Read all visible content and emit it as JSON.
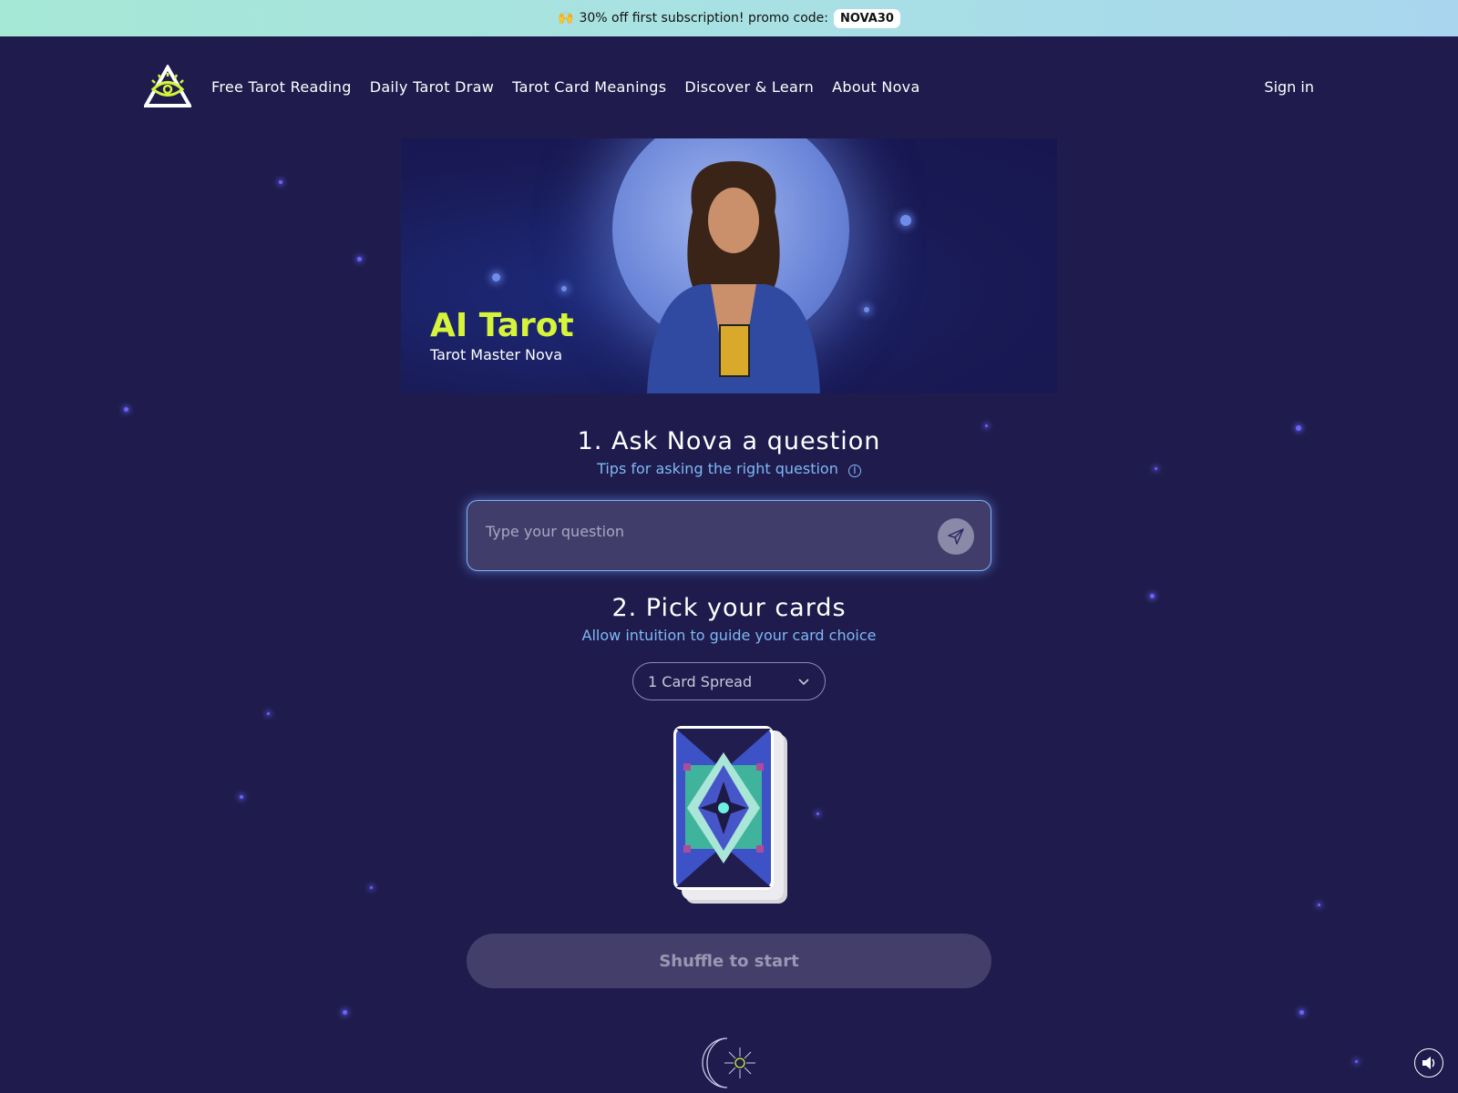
{
  "promo": {
    "emoji": "🙌",
    "text": "30% off first subscription! promo code:",
    "code": "NOVA30"
  },
  "nav": {
    "items": [
      "Free Tarot Reading",
      "Daily Tarot Draw",
      "Tarot Card Meanings",
      "Discover & Learn",
      "About Nova"
    ],
    "sign_in": "Sign in"
  },
  "hero": {
    "title": "AI Tarot",
    "subtitle": "Tarot Master Nova"
  },
  "step1": {
    "title": "1. Ask Nova a question",
    "tips": "Tips for asking the right question",
    "placeholder": "Type your question"
  },
  "step2": {
    "title": "2. Pick your cards",
    "subtitle": "Allow intuition to guide your card choice",
    "spread": "1 Card Spread"
  },
  "shuffle_label": "Shuffle to start",
  "colors": {
    "background": "#1f1c4d",
    "accent": "#d6f43a",
    "link": "#7fb8f5"
  }
}
